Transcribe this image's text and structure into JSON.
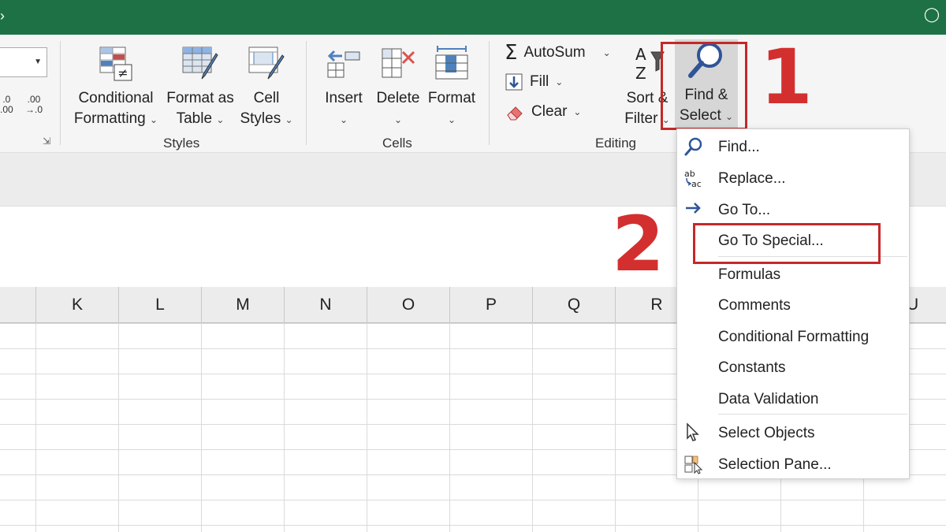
{
  "ribbon": {
    "styles": {
      "label": "Styles",
      "conditional_formatting": {
        "line1": "Conditional",
        "line2": "Formatting"
      },
      "format_as_table": {
        "line1": "Format as",
        "line2": "Table"
      },
      "cell_styles": {
        "line1": "Cell",
        "line2": "Styles"
      }
    },
    "cells": {
      "label": "Cells",
      "insert": "Insert",
      "delete": "Delete",
      "format": "Format"
    },
    "editing": {
      "label": "Editing",
      "autosum": "AutoSum",
      "fill": "Fill",
      "clear": "Clear",
      "sort_filter": {
        "line1": "Sort &",
        "line2": "Filter"
      },
      "find_select": {
        "line1": "Find &",
        "line2": "Select"
      }
    },
    "decimals": {
      "increase": [
        ".0",
        ".00"
      ],
      "decrease": [
        ".00",
        "→.0"
      ]
    }
  },
  "columns": [
    "K",
    "L",
    "M",
    "N",
    "O",
    "P",
    "Q",
    "R",
    "U"
  ],
  "menu": {
    "items": [
      {
        "label": "Find...",
        "icon": "search-icon"
      },
      {
        "label": "Replace...",
        "icon": "replace-icon"
      },
      {
        "label": "Go To...",
        "icon": "arrow-right-icon"
      },
      {
        "label": "Go To Special...",
        "icon": ""
      },
      {
        "label": "Formulas",
        "icon": ""
      },
      {
        "label": "Comments",
        "icon": ""
      },
      {
        "label": "Conditional Formatting",
        "icon": ""
      },
      {
        "label": "Constants",
        "icon": ""
      },
      {
        "label": "Data Validation",
        "icon": ""
      },
      {
        "label": "Select Objects",
        "icon": "cursor-icon"
      },
      {
        "label": "Selection Pane...",
        "icon": "selection-pane-icon"
      }
    ]
  },
  "callouts": {
    "step1": "1",
    "step2": "2"
  },
  "colors": {
    "excel_green": "#1e7145",
    "highlight_red": "#c62828",
    "callout_red": "#d32f2f"
  }
}
